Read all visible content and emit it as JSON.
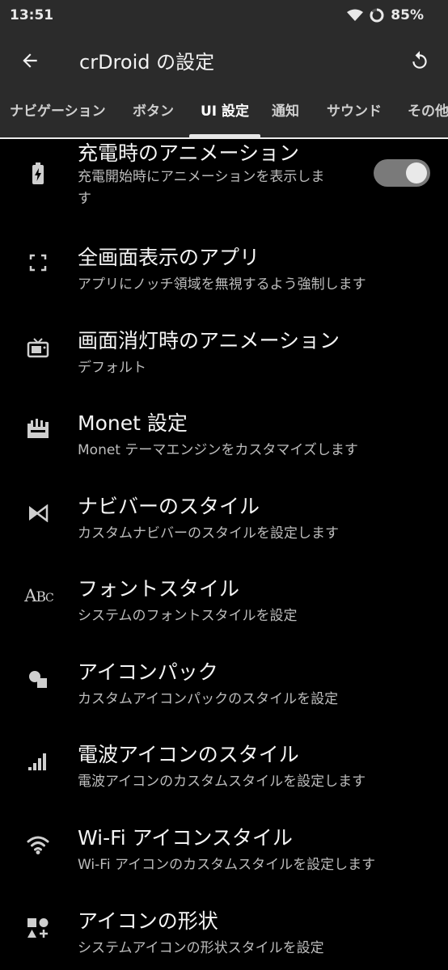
{
  "status": {
    "time": "13:51",
    "battery": "85%"
  },
  "appbar": {
    "title": "crDroid の設定"
  },
  "tabs": [
    {
      "label": "ナビゲーション"
    },
    {
      "label": "ボタン"
    },
    {
      "label": "UI 設定"
    },
    {
      "label": "通知"
    },
    {
      "label": "サウンド"
    },
    {
      "label": "その他"
    }
  ],
  "items": [
    {
      "title": "充電時のアニメーション",
      "subtitle": "充電開始時にアニメーションを表示しま\nす",
      "icon": "battery-charging-icon",
      "toggle_on": true
    },
    {
      "title": "全画面表示のアプリ",
      "subtitle": "アプリにノッチ領域を無視するよう強制します",
      "icon": "fullscreen-icon"
    },
    {
      "title": "画面消灯時のアニメーション",
      "subtitle": "デフォルト",
      "icon": "tv-icon"
    },
    {
      "title": "Monet 設定",
      "subtitle": "Monet テーマエンジンをカスタマイズします",
      "icon": "monet-icon"
    },
    {
      "title": "ナビバーのスタイル",
      "subtitle": "カスタムナビバーのスタイルを設定します",
      "icon": "navbar-icon"
    },
    {
      "title": "フォントスタイル",
      "subtitle": "システムのフォントスタイルを設定",
      "icon": "font-icon",
      "icon_text": "ABC"
    },
    {
      "title": "アイコンパック",
      "subtitle": "カスタムアイコンパックのスタイルを設定",
      "icon": "shapes-icon"
    },
    {
      "title": "電波アイコンのスタイル",
      "subtitle": "電波アイコンのカスタムスタイルを設定します",
      "icon": "signal-icon"
    },
    {
      "title": "Wi-Fi アイコンスタイル",
      "subtitle": "Wi-Fi アイコンのカスタムスタイルを設定します",
      "icon": "wifi-icon"
    },
    {
      "title": "アイコンの形状",
      "subtitle": "システムアイコンの形状スタイルを設定",
      "icon": "icon-shape-icon"
    }
  ]
}
